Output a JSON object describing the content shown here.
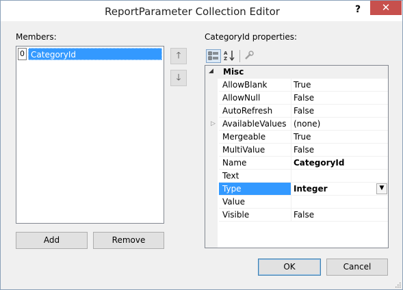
{
  "window": {
    "title": "ReportParameter Collection Editor",
    "help": "?",
    "close": "✕"
  },
  "members": {
    "label": "Members:",
    "items": [
      {
        "index": "0",
        "label": "CategoryId"
      }
    ],
    "up_icon": "arrow-up-icon",
    "down_icon": "arrow-down-icon",
    "up_glyph": "🡑",
    "down_glyph": "🡓",
    "add_label": "Add",
    "remove_label": "Remove"
  },
  "properties": {
    "label": "CategoryId properties:",
    "category": "Misc",
    "rows": [
      {
        "name": "AllowBlank",
        "value": "True"
      },
      {
        "name": "AllowNull",
        "value": "False"
      },
      {
        "name": "AutoRefresh",
        "value": "False"
      },
      {
        "name": "AvailableValues",
        "value": "(none)"
      },
      {
        "name": "Mergeable",
        "value": "True"
      },
      {
        "name": "MultiValue",
        "value": "False"
      },
      {
        "name": "Name",
        "value": "CategoryId"
      },
      {
        "name": "Text",
        "value": ""
      },
      {
        "name": "Type",
        "value": "Integer"
      },
      {
        "name": "Value",
        "value": ""
      },
      {
        "name": "Visible",
        "value": "False"
      }
    ]
  },
  "footer": {
    "ok_label": "OK",
    "cancel_label": "Cancel"
  },
  "colors": {
    "selection": "#3399ff",
    "close_button": "#c7504d"
  }
}
